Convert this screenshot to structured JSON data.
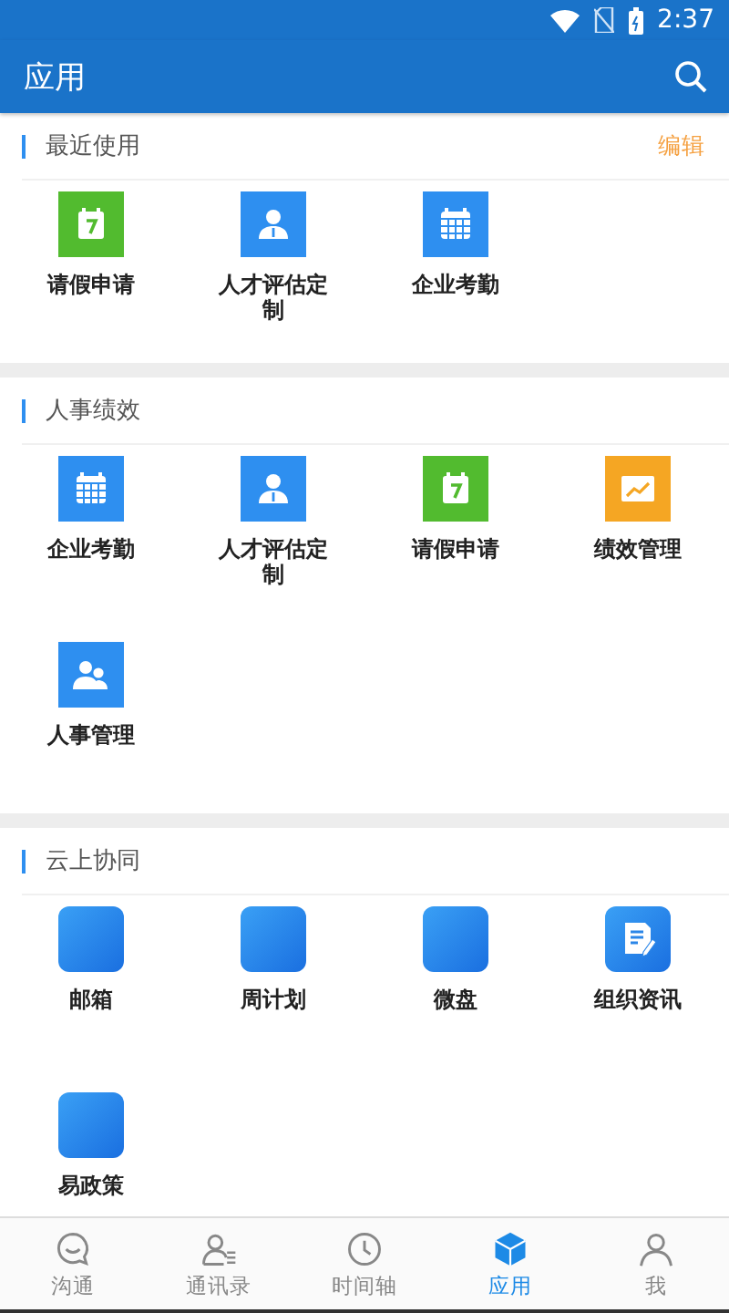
{
  "status_bar": {
    "time": "2:37"
  },
  "app_bar": {
    "title": "应用"
  },
  "sections": [
    {
      "title": "最近使用",
      "action": "编辑",
      "items": [
        {
          "label": "请假申请",
          "kind": "leave"
        },
        {
          "label": "人才评估定制",
          "kind": "person"
        },
        {
          "label": "企业考勤",
          "kind": "attendance"
        }
      ]
    },
    {
      "title": "人事绩效",
      "items": [
        {
          "label": "企业考勤",
          "kind": "attendance"
        },
        {
          "label": "人才评估定制",
          "kind": "person"
        },
        {
          "label": "请假申请",
          "kind": "leave"
        },
        {
          "label": "绩效管理",
          "kind": "chart"
        },
        {
          "label": "人事管理",
          "kind": "people"
        }
      ]
    },
    {
      "title": "云上协同",
      "items": [
        {
          "label": "邮箱",
          "kind": "blank"
        },
        {
          "label": "周计划",
          "kind": "blank"
        },
        {
          "label": "微盘",
          "kind": "blank"
        },
        {
          "label": "组织资讯",
          "kind": "document"
        },
        {
          "label": "易政策",
          "kind": "blank"
        }
      ]
    }
  ],
  "bottom_nav": [
    {
      "label": "沟通",
      "kind": "chat",
      "selected": false
    },
    {
      "label": "通讯录",
      "kind": "contacts",
      "selected": false
    },
    {
      "label": "时间轴",
      "kind": "clock",
      "selected": false
    },
    {
      "label": "应用",
      "kind": "cube",
      "selected": true
    },
    {
      "label": "我",
      "kind": "user",
      "selected": false
    }
  ]
}
